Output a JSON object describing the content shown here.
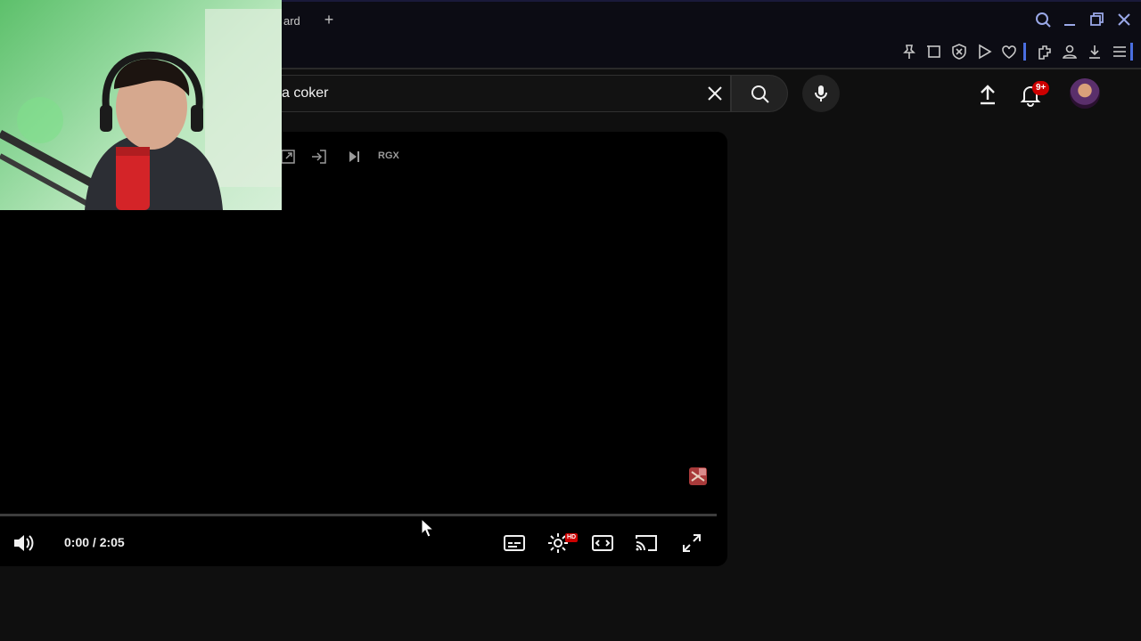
{
  "browser": {
    "tab_partial_label": "ard",
    "new_tab_label": "+"
  },
  "search": {
    "value": "a coker"
  },
  "notifications": {
    "badge": "9+"
  },
  "player": {
    "ext_badge_label": "RGX",
    "time_display": "0:00 / 2:05",
    "progress": 0,
    "hd_label": "HD"
  },
  "colors": {
    "accent_red": "#ff0000",
    "background": "#0f0f0f",
    "player_bg": "#000000",
    "webcam_bg": "#8fd79a"
  }
}
